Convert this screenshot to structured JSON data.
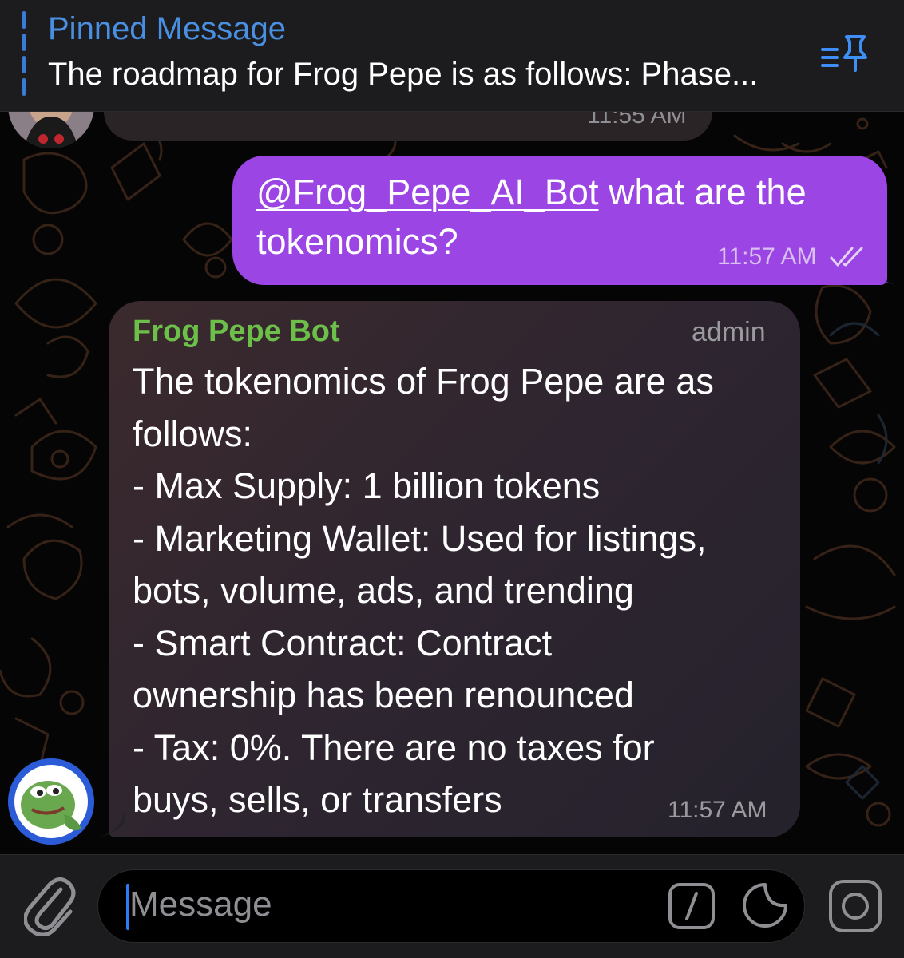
{
  "pinned": {
    "title": "Pinned Message",
    "preview": "The roadmap for Frog Pepe is as follows: Phase...",
    "icon": "pinned-list-icon"
  },
  "previous_message": {
    "time": "11:55 AM"
  },
  "outgoing_message": {
    "mention": "@Frog_Pepe_AI_Bot",
    "text": " what are the tokenomics?",
    "time": "11:57 AM",
    "status_icon": "double-check-icon",
    "bubble_color": "#9b45e4"
  },
  "incoming_message": {
    "sender": "Frog Pepe Bot",
    "sender_color": "#6cc04a",
    "role": "admin",
    "lines": [
      "The tokenomics of Frog Pepe are as",
      "follows:",
      "- Max Supply: 1 billion tokens",
      "- Marketing Wallet: Used for listings,",
      "bots, volume, ads, and trending",
      "- Smart Contract: Contract",
      "ownership has been renounced",
      "- Tax: 0%. There are no taxes for",
      "buys, sells, or transfers"
    ],
    "time": "11:57 AM"
  },
  "input_bar": {
    "placeholder": "Message",
    "icons": [
      "paperclip-icon",
      "bot-command-icon",
      "sticker-icon",
      "camera-icon"
    ],
    "accent_color": "#2d7cf6"
  }
}
